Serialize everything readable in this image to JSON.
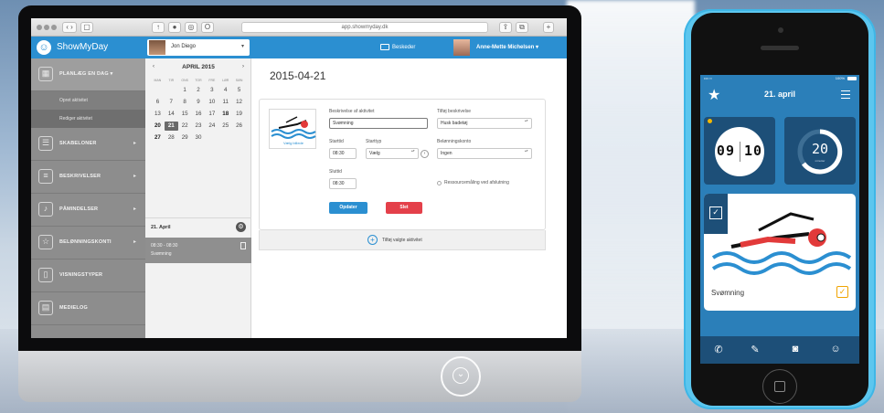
{
  "browser": {
    "url": "app.showmyday.dk"
  },
  "app": {
    "logo_text": "ShowMyDay",
    "user_select": "Jon Diego",
    "messages_label": "Beskeder",
    "account_name": "Anne-Mette Michelsen"
  },
  "sidebar": {
    "items": [
      {
        "label": "PLANLÆG EN DAG",
        "icon": "calendar-icon"
      },
      {
        "label": "SKABELONER",
        "icon": "list-icon"
      },
      {
        "label": "BESKRIVELSER",
        "icon": "document-icon"
      },
      {
        "label": "PÅMINDELSER",
        "icon": "bell-icon"
      },
      {
        "label": "BELØNNINGSKONTI",
        "icon": "star-icon"
      },
      {
        "label": "VISNINGSTYPER",
        "icon": "device-icon"
      },
      {
        "label": "MEDIELOG",
        "icon": "media-icon"
      }
    ],
    "subitems": [
      "Opret aktivitet",
      "Rediger aktivitet"
    ]
  },
  "calendar": {
    "month": "APRIL 2015",
    "prev": "‹",
    "next": "›",
    "weekdays": [
      "MAN",
      "TIR",
      "ONS",
      "TOR",
      "FRE",
      "LØR",
      "SØN"
    ],
    "days": [
      "",
      "",
      "1",
      "2",
      "3",
      "4",
      "5",
      "6",
      "7",
      "8",
      "9",
      "10",
      "11",
      "12",
      "13",
      "14",
      "15",
      "16",
      "17",
      "18",
      "19",
      "20",
      "21",
      "22",
      "23",
      "24",
      "25",
      "26",
      "27",
      "28",
      "29",
      "30",
      "",
      "",
      ""
    ],
    "selected_day": "21",
    "day_label": "21. April",
    "event_time": "08:30 - 08:30",
    "event_name": "Svømning"
  },
  "main": {
    "date_title": "2015-04-21",
    "image_link": "Vælg billede",
    "desc_label": "Beskrivelse af aktivitet",
    "desc_value": "Svømning",
    "add_desc_label": "Tilføj beskrivelse",
    "add_desc_value": "Husk badetøj",
    "start_label": "Starttid",
    "start_value": "08:30",
    "starttype_label": "Starttyp",
    "starttype_value": "Vælg",
    "reward_label": "Belønningskonto",
    "reward_value": "Ingen",
    "end_label": "Sluttid",
    "end_value": "08:30",
    "resource_label": "Ressourcemåling ved afslutning",
    "update_btn": "Opdater",
    "delete_btn": "Slet",
    "add_selected": "Tilføj valgte aktivitet"
  },
  "phone": {
    "status_left": "•••○○",
    "status_right": "100%",
    "date": "21. april",
    "clock_h": "09",
    "clock_m": "10",
    "minutes": "20",
    "minutes_unit": "minutter",
    "activity": "Svømning"
  }
}
